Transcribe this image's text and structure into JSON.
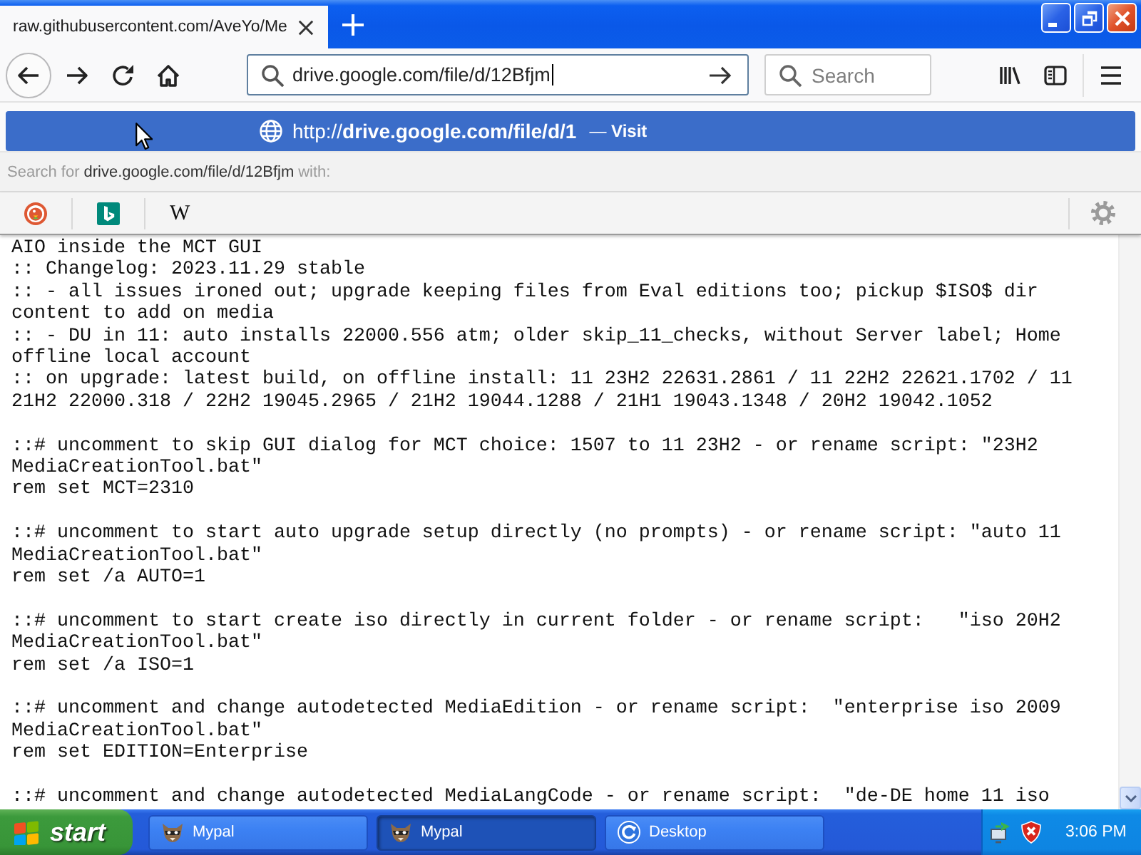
{
  "tabs": [
    {
      "title": "raw.githubusercontent.com/AveYo/Me",
      "selected": true
    }
  ],
  "toolbar": {
    "address": {
      "value": "drive.google.com/file/d/12Bfjm",
      "focused": true
    },
    "search": {
      "placeholder": "Search"
    }
  },
  "url_popup": {
    "results": [
      {
        "url": "http://**drive.google.com/file/d/1**",
        "action": "— **Visit**",
        "selected": true
      }
    ],
    "search_with": {
      "prefix": "Search for",
      "query": "drive.google.com/file/d/12Bfjm",
      "suffix": "with:"
    },
    "engines": [
      {
        "kind": "duck"
      },
      {
        "kind": "tile"
      },
      {
        "kind": "letter",
        "label": "W"
      }
    ]
  },
  "document": {
    "blocks": [
      [
        "AIO inside the MCT GUI",
        ":: Changelog: 2023.11.29 stable",
        ":: - all issues ironed out; upgrade keeping files from Eval editions too; pickup $ISO$ dir content to add on media",
        ":: - DU in 11: auto installs 22000.556 atm; older skip_11_checks, without Server label; Home offline local account",
        ":: on upgrade: latest build, on offline install: 11 23H2 22631.2861 / 11 22H2 22621.1702 / 11 21H2 22000.318 / 22H2 19045.2965 / 21H2 19044.1288 / 21H1 19043.1348 / 20H2 19042.1052"
      ],
      [
        "::# uncomment to skip GUI dialog for MCT choice: 1507 to 11 23H2 - or rename script: \"23H2 MediaCreationTool.bat\"",
        "rem set MCT=2310"
      ],
      [
        "::# uncomment to start auto upgrade setup directly (no prompts) - or rename script: \"auto 11 MediaCreationTool.bat\"",
        "rem set /a AUTO=1"
      ],
      [
        "::# uncomment to start create iso directly in current folder - or rename script:   \"iso 20H2 MediaCreationTool.bat\"",
        "rem set /a ISO=1"
      ],
      [
        "::# uncomment and change autodetected MediaEdition - or rename script:  \"enterprise iso 2009 MediaCreationTool.bat\"",
        "rem set EDITION=Enterprise"
      ],
      [
        "::# uncomment and change autodetected MediaLangCode - or rename script:  \"de-DE home 11 iso"
      ]
    ]
  },
  "taskbar": {
    "start": "start",
    "tasks": [
      {
        "label": "Mypal",
        "kind": "mascot",
        "selected": false
      },
      {
        "label": "Mypal",
        "kind": "mascot",
        "selected": true
      },
      {
        "label": "Desktop",
        "kind": "desktop",
        "selected": false
      }
    ],
    "time": "3:06 PM"
  }
}
